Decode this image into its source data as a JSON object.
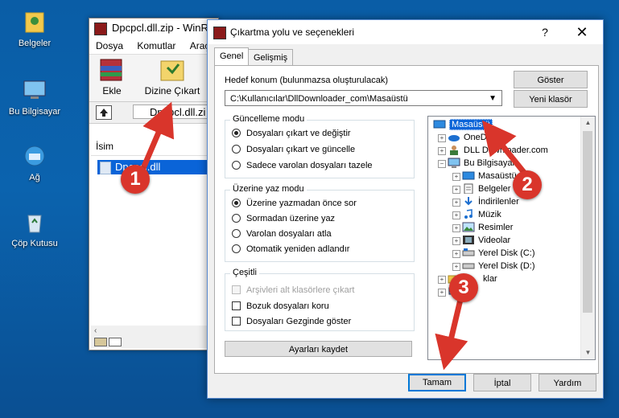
{
  "desktop": {
    "icons": [
      {
        "label": "Belgeler",
        "icon": "documents-folder-icon"
      },
      {
        "label": "Bu Bilgisayar",
        "icon": "computer-icon"
      },
      {
        "label": "Ağ",
        "icon": "network-icon"
      },
      {
        "label": "Çöp Kutusu",
        "icon": "recycle-bin-icon"
      }
    ]
  },
  "winrar": {
    "title": "Dpcpcl.dll.zip - WinR",
    "menu": [
      "Dosya",
      "Komutlar",
      "Araçla"
    ],
    "toolbar": {
      "add_label": "Ekle",
      "extract_label": "Dizine Çıkart"
    },
    "address": "Dpcpcl.dll.zi",
    "list_header": "İsim",
    "file_name": "Dpcpcl.dll"
  },
  "dialog": {
    "title": "Çıkartma yolu ve seçenekleri",
    "help": "?",
    "close": "✕",
    "tabs": [
      "Genel",
      "Gelişmiş"
    ],
    "dest_label": "Hedef konum (bulunmazsa oluşturulacak)",
    "dest_value": "C:\\Kullanıcılar\\DllDownloader_com\\Masaüstü",
    "show_button": "Göster",
    "new_folder_button": "Yeni klasör",
    "update_group": {
      "title": "Güncelleme modu",
      "options": [
        "Dosyaları çıkart ve değiştir",
        "Dosyaları çıkart ve güncelle",
        "Sadece varolan dosyaları tazele"
      ],
      "selected": 0
    },
    "overwrite_group": {
      "title": "Üzerine yaz modu",
      "options": [
        "Üzerine yazmadan önce sor",
        "Sormadan üzerine yaz",
        "Varolan dosyaları atla",
        "Otomatik yeniden adlandır"
      ],
      "selected": 0
    },
    "misc_group": {
      "title": "Çeşitli",
      "options": [
        "Arşivleri alt klasörlere çıkart",
        "Bozuk dosyaları koru",
        "Dosyaları Gezginde göster"
      ]
    },
    "save_settings_button": "Ayarları kaydet",
    "tree": [
      {
        "label": "Masaüstü",
        "icon": "desktop-icon",
        "selected": true
      },
      {
        "label": "OneD",
        "icon": "onedrive-icon"
      },
      {
        "label": "DLL Downloader.com",
        "icon": "user-folder-icon"
      },
      {
        "label": "Bu Bilgisayar",
        "icon": "computer-icon"
      },
      {
        "label": "Masaüstü",
        "icon": "desktop-icon"
      },
      {
        "label": "Belgeler",
        "icon": "documents-icon"
      },
      {
        "label": "İndirilenler",
        "icon": "downloads-icon"
      },
      {
        "label": "Müzik",
        "icon": "music-icon"
      },
      {
        "label": "Resimler",
        "icon": "pictures-icon"
      },
      {
        "label": "Videolar",
        "icon": "videos-icon"
      },
      {
        "label": "Yerel Disk (C:)",
        "icon": "drive-icon"
      },
      {
        "label": "Yerel Disk (D:)",
        "icon": "drive-icon"
      },
      {
        "label": "klar",
        "icon": "folder-icon"
      },
      {
        "label": "",
        "icon": "network-icon"
      }
    ],
    "ok_button": "Tamam",
    "cancel_button": "İptal",
    "help_button": "Yardım"
  },
  "annotations": [
    "1",
    "2",
    "3"
  ],
  "colors": {
    "accent": "#0078d7",
    "selection": "#0a64d8",
    "annotation": "#d9352b",
    "desktop": "#0b63ae"
  }
}
